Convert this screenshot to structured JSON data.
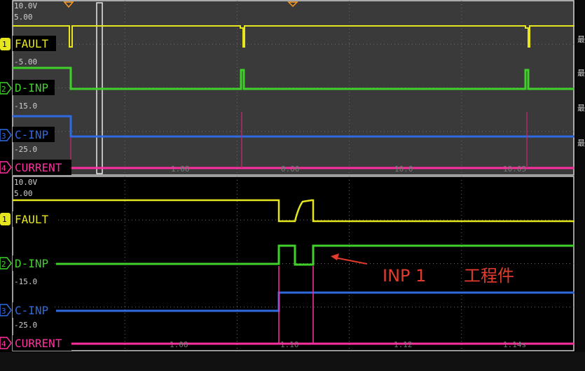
{
  "colors": {
    "fault": "#e6e620",
    "d_inp": "#3fd12a",
    "c_inp": "#2f6ae0",
    "current": "#ff2fa0",
    "annotation": "#e23b2e",
    "grid": "#6a6a6a",
    "top_bg": "#3a3a3a",
    "bottom_bg": "#000000"
  },
  "top_pane": {
    "scale_labels": [
      "10.0V",
      "5.00",
      "-5.00",
      "-15.0",
      "-25.0"
    ],
    "time_ticks": [
      "1.08",
      "0.00",
      "10.0",
      "10.05"
    ],
    "channels": [
      {
        "id": "fault",
        "label": "FAULT",
        "marker": "1"
      },
      {
        "id": "d_inp",
        "label": "D-INP",
        "marker": "2"
      },
      {
        "id": "c_inp",
        "label": "C-INP",
        "marker": "3"
      },
      {
        "id": "current",
        "label": "CURRENT",
        "marker": "4"
      }
    ],
    "side_glyphs": [
      "最",
      "最",
      "最",
      "最"
    ]
  },
  "bottom_pane": {
    "scale_labels": [
      "10.0V",
      "5.00",
      "-15.0",
      "-25.0"
    ],
    "time_ticks": [
      "1.08",
      "1.10",
      "1.12",
      "1.14s"
    ],
    "channels": [
      {
        "id": "fault",
        "label": "FAULT",
        "marker": "1"
      },
      {
        "id": "d_inp",
        "label": "D-INP",
        "marker": "2"
      },
      {
        "id": "c_inp",
        "label": "C-INP",
        "marker": "3"
      },
      {
        "id": "current",
        "label": "CURRENT",
        "marker": "4"
      }
    ]
  },
  "annotation": {
    "text_left": "INP 1",
    "text_right": "工程件"
  }
}
